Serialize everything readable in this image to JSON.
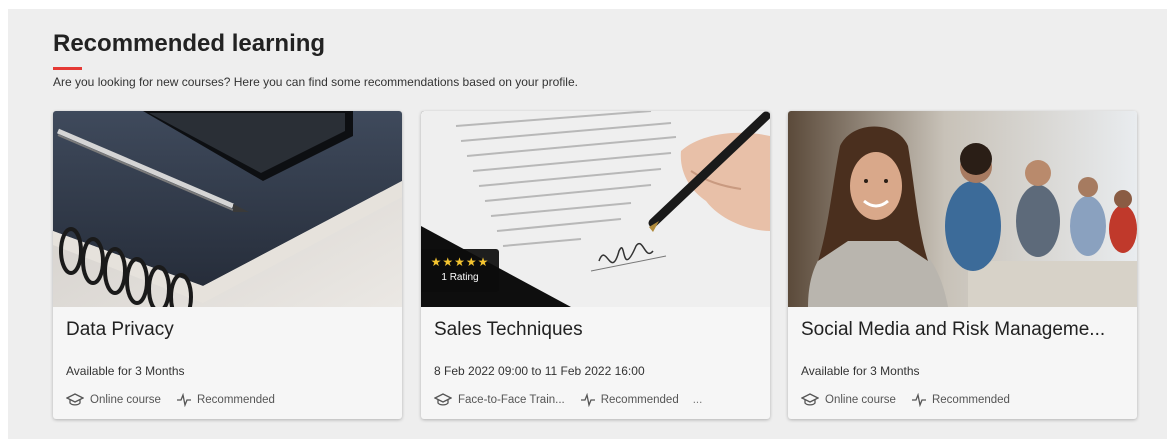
{
  "section": {
    "title": "Recommended learning",
    "subtitle": "Are you looking for new courses? Here you can find some recommendations based on your profile."
  },
  "colors": {
    "accent": "#e53935",
    "panel": "#eeeeee",
    "star": "#f4c430"
  },
  "courses": [
    {
      "title": "Data Privacy",
      "availability": "Available for 3 Months",
      "type": "Online course",
      "type_icon": "graduation-cap-icon",
      "tag": "Recommended",
      "tag_icon": "pulse-icon",
      "image": "notebook-and-phone"
    },
    {
      "title": "Sales Techniques",
      "availability": "8 Feb 2022 09:00 to 11 Feb 2022 16:00",
      "type": "Face-to-Face Train...",
      "type_icon": "graduation-cap-icon",
      "tag": "Recommended",
      "tag_icon": "pulse-icon",
      "more": "...",
      "rating": {
        "stars": "★★★★★",
        "label": "1 Rating",
        "value": 5
      },
      "image": "hand-signing-document"
    },
    {
      "title": "Social Media and Risk Manageme...",
      "availability": "Available for 3 Months",
      "type": "Online course",
      "type_icon": "graduation-cap-icon",
      "tag": "Recommended",
      "tag_icon": "pulse-icon",
      "image": "smiling-woman-in-meeting"
    }
  ]
}
